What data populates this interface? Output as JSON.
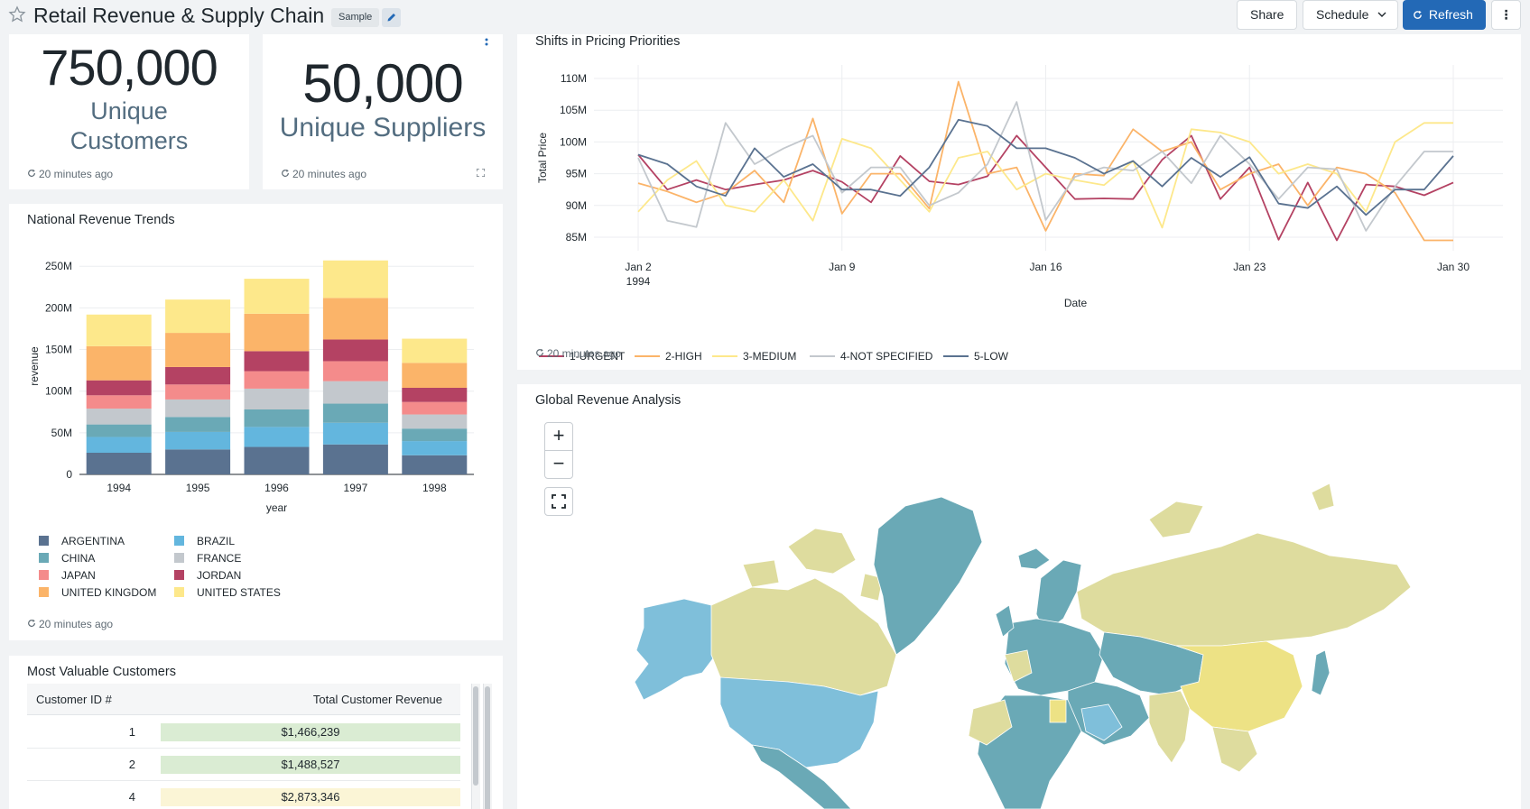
{
  "header": {
    "title": "Retail Revenue & Supply Chain",
    "tag": "Sample",
    "share_label": "Share",
    "schedule_label": "Schedule",
    "refresh_label": "Refresh",
    "more_label": "⋮"
  },
  "counters": [
    {
      "value": "750,000",
      "label_line1": "Unique",
      "label_line2": "Customers",
      "updated": "20 minutes ago"
    },
    {
      "value": "50,000",
      "label_line1": "Unique Suppliers",
      "updated": "20 minutes ago"
    }
  ],
  "revenue_trends": {
    "title": "National Revenue Trends",
    "updated": "20 minutes ago"
  },
  "pricing": {
    "title": "Shifts in Pricing Priorities",
    "updated": "20 minutes ago"
  },
  "customers_table": {
    "title": "Most Valuable Customers",
    "col_id": "Customer ID #",
    "col_revenue": "Total Customer Revenue",
    "rows": [
      {
        "id": "1",
        "revenue": "$1,466,239",
        "color": "#daecd3"
      },
      {
        "id": "2",
        "revenue": "$1,488,527",
        "color": "#daecd3"
      },
      {
        "id": "4",
        "revenue": "$2,873,346",
        "color": "#fbf5d6"
      }
    ]
  },
  "map": {
    "title": "Global Revenue Analysis",
    "zoom_in": "+",
    "zoom_out": "−"
  },
  "chart_data": [
    {
      "type": "bar",
      "stacked": true,
      "categories": [
        "1994",
        "1995",
        "1996",
        "1997",
        "1998"
      ],
      "xlabel": "year",
      "ylabel": "revenue",
      "ylim": [
        0,
        260000000
      ],
      "yticks": [
        0,
        50000000,
        100000000,
        150000000,
        200000000,
        250000000
      ],
      "ytick_labels": [
        "0",
        "50M",
        "100M",
        "150M",
        "200M",
        "250M"
      ],
      "legend_position": "bottom",
      "series": [
        {
          "name": "ARGENTINA",
          "color": "#5a7290",
          "values": [
            26000000,
            30000000,
            33000000,
            36000000,
            23000000
          ]
        },
        {
          "name": "BRAZIL",
          "color": "#63b6de",
          "values": [
            19000000,
            21000000,
            24000000,
            26000000,
            17000000
          ]
        },
        {
          "name": "CHINA",
          "color": "#6aa9b6",
          "values": [
            15000000,
            18000000,
            21000000,
            23000000,
            15000000
          ]
        },
        {
          "name": "FRANCE",
          "color": "#c3c8cd",
          "values": [
            19000000,
            21000000,
            25000000,
            27000000,
            17000000
          ]
        },
        {
          "name": "JAPAN",
          "color": "#f48b8b",
          "values": [
            16000000,
            18000000,
            21000000,
            24000000,
            15000000
          ]
        },
        {
          "name": "JORDAN",
          "color": "#b44263",
          "values": [
            18000000,
            21000000,
            24000000,
            26000000,
            17000000
          ]
        },
        {
          "name": "UNITED KINGDOM",
          "color": "#fbb469",
          "values": [
            41000000,
            41000000,
            45000000,
            50000000,
            30000000
          ]
        },
        {
          "name": "UNITED STATES",
          "color": "#fde88b",
          "values": [
            38000000,
            40000000,
            42000000,
            45000000,
            29000000
          ]
        }
      ]
    },
    {
      "type": "line",
      "xlabel": "Date",
      "ylabel": "Total Price",
      "ylim": [
        84000000,
        111000000
      ],
      "yticks": [
        85000000,
        90000000,
        95000000,
        100000000,
        105000000,
        110000000
      ],
      "ytick_labels": [
        "85M",
        "90M",
        "95M",
        "100M",
        "105M",
        "110M"
      ],
      "x_start": "1994-01-02",
      "xticks": [
        "1994-01-02",
        "1994-01-09",
        "1994-01-16",
        "1994-01-23",
        "1994-01-30"
      ],
      "xtick_labels": [
        "Jan 2",
        "Jan 9",
        "Jan 16",
        "Jan 23",
        "Jan 30"
      ],
      "xtick_sublabel": "1994",
      "legend_position": "bottom",
      "series": [
        {
          "name": "1-URGENT",
          "color": "#b44263",
          "values": [
            98,
            92.5,
            94,
            92.5,
            93.3,
            94,
            95.5,
            93.7,
            90.5,
            97.8,
            93.8,
            93.3,
            94.6,
            101,
            96,
            91,
            91.1,
            91,
            97.2,
            101,
            91,
            96,
            84.6,
            93.6,
            84.5,
            93.3,
            93,
            91.6,
            93.6
          ]
        },
        {
          "name": "2-HIGH",
          "color": "#fbb469",
          "values": [
            93.5,
            92.2,
            90.5,
            92,
            95.5,
            90.5,
            103.7,
            88.7,
            95,
            95,
            89.5,
            109.5,
            95,
            96,
            86,
            95,
            94.7,
            102,
            98.5,
            100,
            92.5,
            95,
            96.5,
            90,
            96,
            95,
            92,
            84.5,
            84.5
          ]
        },
        {
          "name": "3-MEDIUM",
          "color": "#fde88b",
          "values": [
            89,
            94,
            97,
            90,
            89,
            94,
            87.6,
            100.5,
            99,
            94,
            89,
            97.5,
            98.5,
            92.5,
            95,
            94,
            93.2,
            97,
            86.5,
            102,
            101.5,
            100,
            95,
            96.5,
            95,
            89,
            100,
            103,
            103
          ]
        },
        {
          "name": "4-NOT SPECIFIED",
          "color": "#c3c8cd",
          "values": [
            97.5,
            87.6,
            86.6,
            103,
            96.5,
            99,
            101,
            92,
            96,
            96,
            90,
            92,
            96.5,
            106.3,
            87.7,
            94.5,
            96,
            95.5,
            98.5,
            93.5,
            101,
            96.5,
            91,
            96,
            95.7,
            86,
            93,
            98.5,
            98.5
          ]
        },
        {
          "name": "5-LOW",
          "color": "#5a7290",
          "values": [
            98,
            96.5,
            93,
            91.5,
            99,
            94.5,
            96.5,
            92.5,
            92.5,
            91.5,
            96,
            103.5,
            102.5,
            99,
            99,
            97.5,
            95,
            97,
            93,
            97.5,
            94.5,
            97.6,
            90.3,
            89.6,
            93,
            88.5,
            92.5,
            92.5,
            97.8
          ]
        }
      ]
    }
  ]
}
